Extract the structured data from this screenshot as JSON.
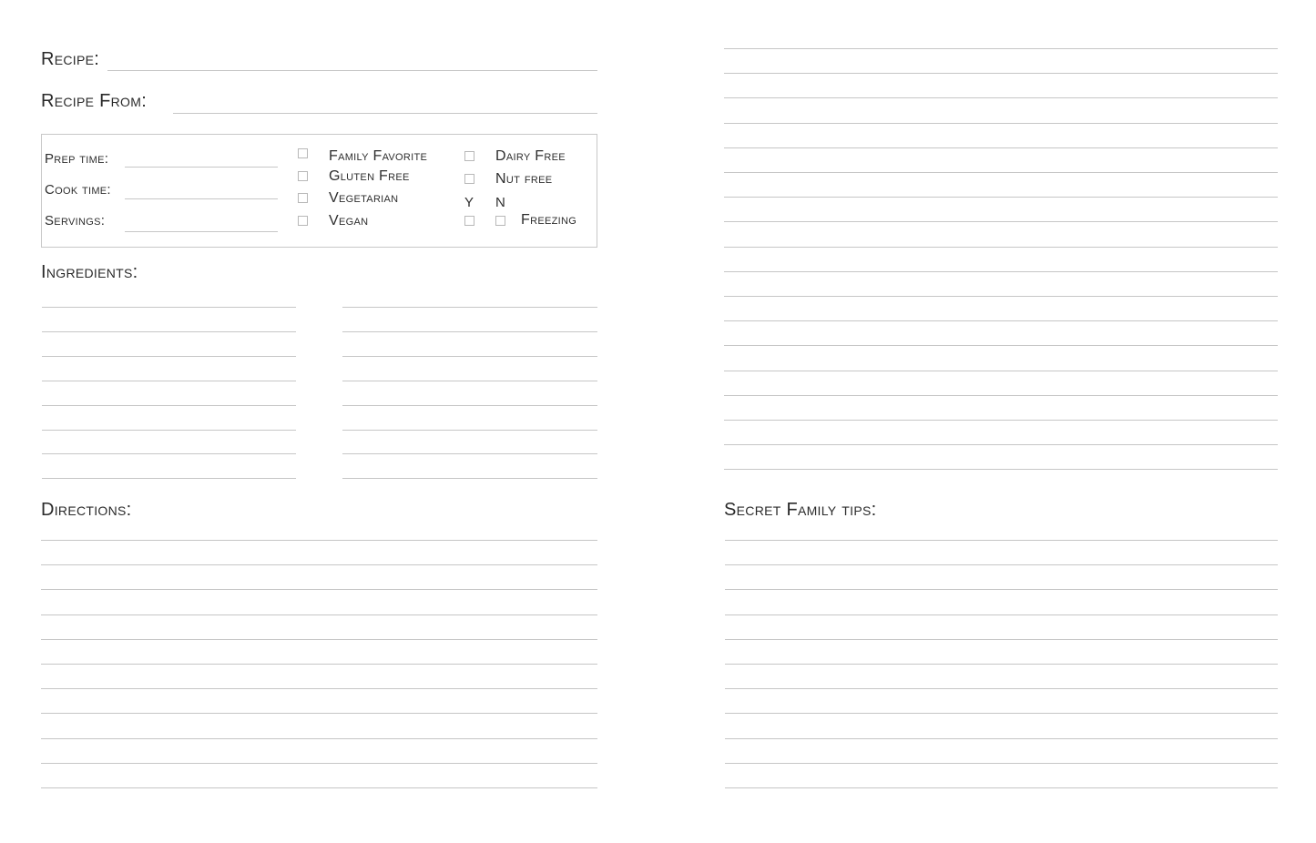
{
  "left_page": {
    "recipe_label": "Recipe:",
    "recipe_from_label": "Recipe From:",
    "info_box": {
      "fields": [
        {
          "label": "Prep time:",
          "value": ""
        },
        {
          "label": "Cook time:",
          "value": ""
        },
        {
          "label": "Servings:",
          "value": ""
        }
      ],
      "checkboxes_col1": [
        {
          "label": "Family Favorite",
          "checked": false
        },
        {
          "label": "Gluten Free",
          "checked": false
        },
        {
          "label": "Vegetarian",
          "checked": false
        },
        {
          "label": "Vegan",
          "checked": false
        }
      ],
      "checkboxes_col2": [
        {
          "label": "Dairy Free",
          "checked": false
        },
        {
          "label": "Nut free",
          "checked": false
        }
      ],
      "freezing": {
        "yes_label": "Y",
        "no_label": "N",
        "label": "Freezing",
        "yes_checked": false,
        "no_checked": false
      }
    },
    "ingredients_label": "Ingredients:",
    "ingredients_lines_per_column": 8,
    "directions_label": "Directions:",
    "directions_lines": 11
  },
  "right_page": {
    "notes_lines": 18,
    "secret_tips_label": "Secret Family tips:",
    "secret_tips_lines": 11
  },
  "colors": {
    "rule": "#c6c6c6",
    "text": "#2e2e2e",
    "box_border": "#c8c8c8"
  }
}
